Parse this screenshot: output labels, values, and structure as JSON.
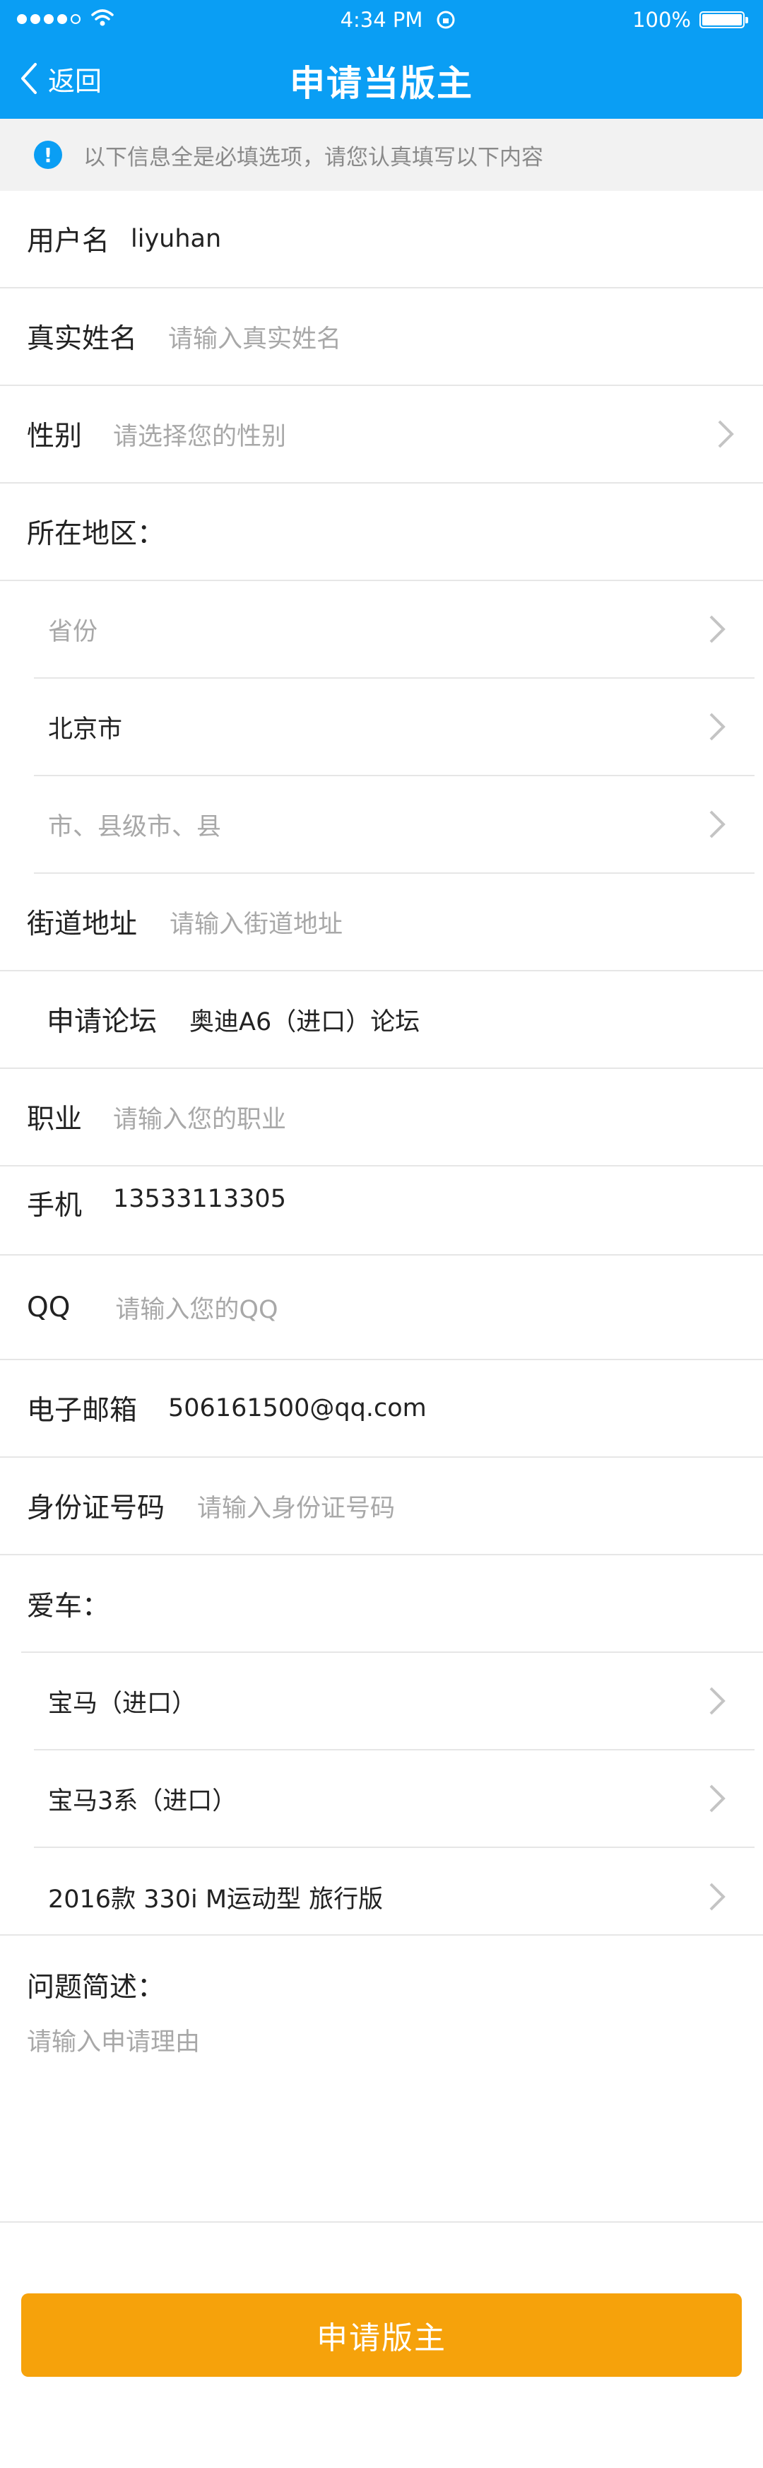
{
  "status_bar": {
    "time": "4:34 PM",
    "battery": "100%"
  },
  "nav": {
    "back_label": "返回",
    "title": "申请当版主"
  },
  "notice": "以下信息全是必填选项，请您认真填写以下内容",
  "form": {
    "username": {
      "label": "用户名",
      "value": "liyuhan"
    },
    "real_name": {
      "label": "真实姓名",
      "placeholder": "请输入真实姓名"
    },
    "gender": {
      "label": "性别",
      "placeholder": "请选择您的性别"
    },
    "region": {
      "label": "所在地区：",
      "province": "省份",
      "city": "北京市",
      "county": "市、县级市、县"
    },
    "street": {
      "label": "街道地址",
      "placeholder": "请输入街道地址"
    },
    "forum": {
      "label": "申请论坛",
      "value": "奥迪A6（进口）论坛"
    },
    "job": {
      "label": "职业",
      "placeholder": "请输入您的职业"
    },
    "phone": {
      "label": "手机",
      "value": "13533113305"
    },
    "qq": {
      "label": "QQ",
      "placeholder": "请输入您的QQ"
    },
    "email": {
      "label": "电子邮箱",
      "value": "506161500@qq.com"
    },
    "id_number": {
      "label": "身份证号码",
      "placeholder": "请输入身份证号码"
    },
    "car": {
      "label": "爱车：",
      "brand": "宝马（进口）",
      "series": "宝马3系（进口）",
      "model": "2016款 330i M运动型 旅行版"
    },
    "description": {
      "label": "问题简述：",
      "placeholder": "请输入申请理由"
    }
  },
  "submit_label": "申请版主",
  "colors": {
    "primary": "#0a9ef4",
    "button": "#f6a20b"
  }
}
